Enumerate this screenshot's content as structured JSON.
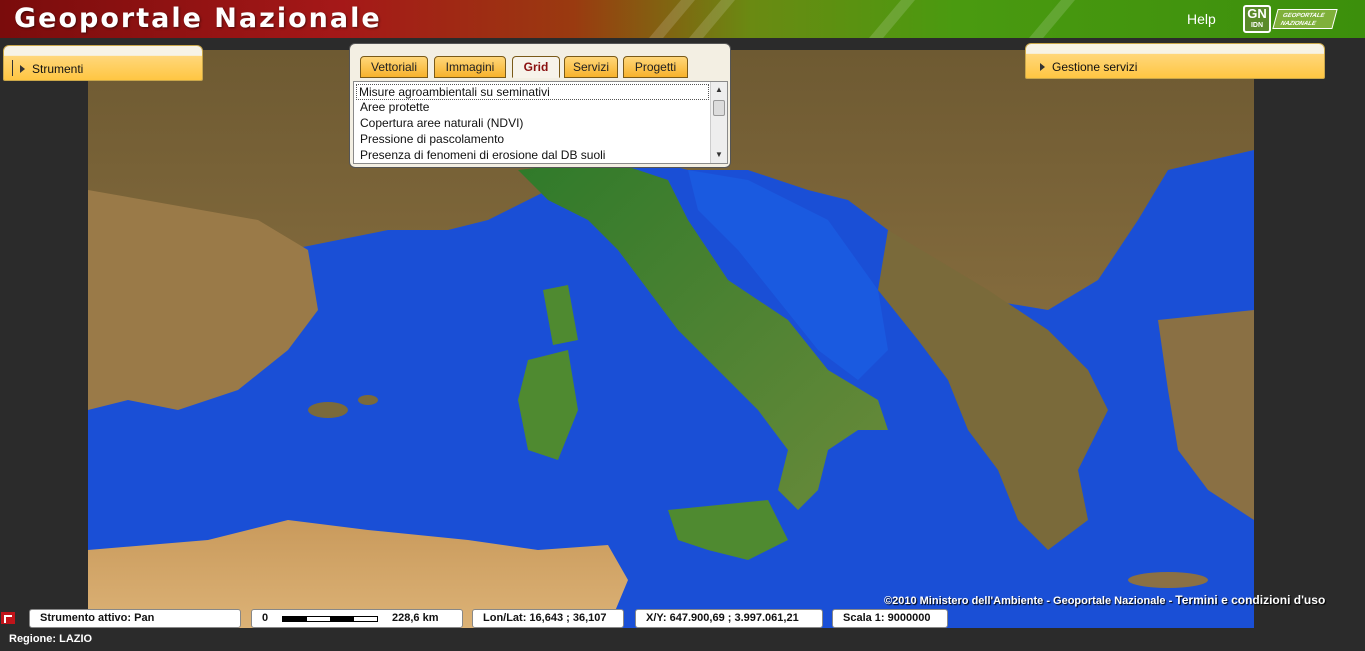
{
  "header": {
    "title": "Geoportale Nazionale",
    "help_label": "Help",
    "logo": {
      "mark": "GN",
      "sub": "IDN",
      "text_line1": "GEOPORTALE",
      "text_line2": "NAZIONALE"
    }
  },
  "panels": {
    "tools": {
      "label": "Strumenti"
    },
    "services": {
      "label": "Gestione servizi"
    }
  },
  "layers": {
    "tabs": [
      {
        "label": "Vettoriali",
        "active": false
      },
      {
        "label": "Immagini",
        "active": false
      },
      {
        "label": "Grid",
        "active": true
      },
      {
        "label": "Servizi",
        "active": false
      },
      {
        "label": "Progetti",
        "active": false
      }
    ],
    "items": [
      "Misure agroambientali su seminativi",
      "Aree protette",
      "Copertura aree naturali (NDVI)",
      "Pressione di pascolamento",
      "Presenza di fenomeni di erosione dal DB suoli"
    ],
    "selected_index": 0
  },
  "map": {
    "copyright": "©2010 Ministero dell'Ambiente - Geoportale Nazionale -",
    "terms": "Termini e condizioni d'uso"
  },
  "status": {
    "tool": "Strumento attivo: Pan",
    "scale_start": "0",
    "scale_end": "228,6 km",
    "lonlat": "Lon/Lat: 16,643 ; 36,107",
    "xy": "X/Y: 647.900,69 ; 3.997.061,21",
    "scale": "Scala 1: 9000000"
  },
  "region": "Regione: LAZIO",
  "colors": {
    "accent": "#ffc642",
    "header_red": "#a51818",
    "header_green": "#3c8f0c",
    "sea": "#1a4fd6"
  }
}
